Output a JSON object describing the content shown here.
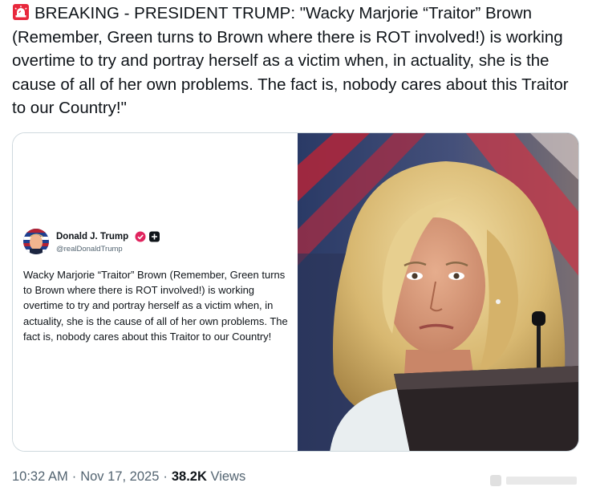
{
  "tweet": {
    "text": "BREAKING - PRESIDENT TRUMP: \"Wacky Marjorie “Traitor” Brown (Remember, Green turns to Brown where there is ROT involved!) is working overtime to try and portray herself as a victim when, in actuality, she is the cause of all of her own problems. The fact is, nobody cares about this Traitor to our Country!\"",
    "siren_icon": "police-light-icon"
  },
  "embed": {
    "author_name": "Donald J. Trump",
    "author_handle": "@realDonaldTrump",
    "text": "Wacky Marjorie “Traitor” Brown (Remember, Green turns to Brown where there is ROT involved!) is working overtime to try and portray herself as a victim when, in actuality, she is the cause of all of her own problems. The fact is, nobody cares about this Traitor to our Country!",
    "verified_color": "#e0245e",
    "badge_icon": "truth-plus-icon"
  },
  "photo": {
    "icon": "photo-woman-portrait"
  },
  "meta": {
    "time": "10:32 AM",
    "separator": "·",
    "date": "Nov 17, 2025",
    "views_count": "38.2K",
    "views_label": "Views"
  },
  "colors": {
    "text": "#0f1419",
    "secondary": "#536471",
    "border": "#cfd9de",
    "siren": "#e8283c"
  }
}
